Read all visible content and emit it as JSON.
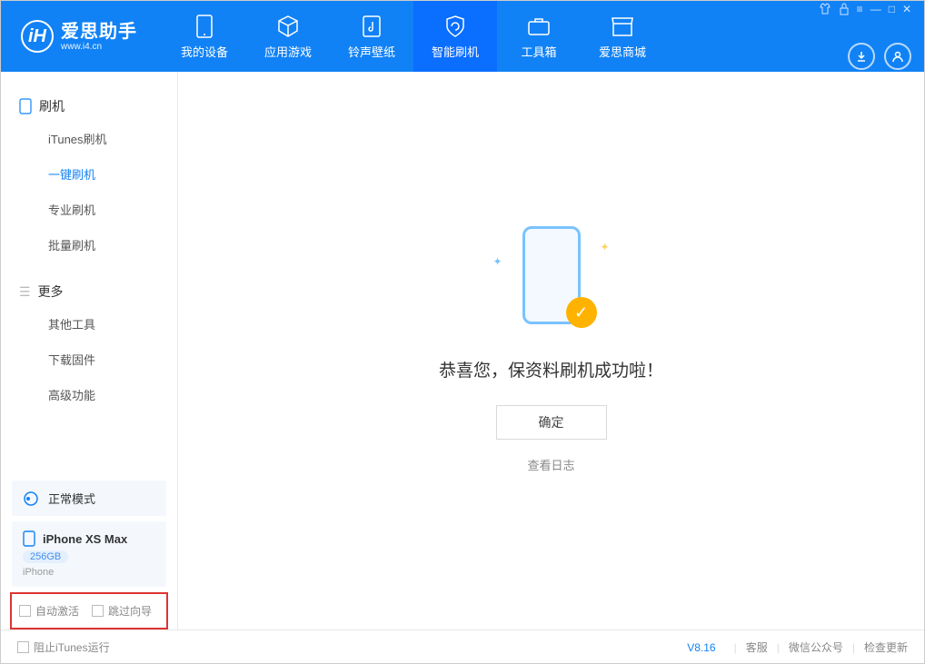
{
  "logo": {
    "title": "爱思助手",
    "sub": "www.i4.cn"
  },
  "nav": {
    "tabs": [
      {
        "label": "我的设备",
        "icon": "phone"
      },
      {
        "label": "应用游戏",
        "icon": "cube"
      },
      {
        "label": "铃声壁纸",
        "icon": "music-file"
      },
      {
        "label": "智能刷机",
        "icon": "refresh-shield",
        "active": true
      },
      {
        "label": "工具箱",
        "icon": "toolbox"
      },
      {
        "label": "爱思商城",
        "icon": "store"
      }
    ]
  },
  "sidebar": {
    "group1": {
      "label": "刷机",
      "items": [
        {
          "label": "iTunes刷机"
        },
        {
          "label": "一键刷机",
          "active": true
        },
        {
          "label": "专业刷机"
        },
        {
          "label": "批量刷机"
        }
      ]
    },
    "group2": {
      "label": "更多",
      "items": [
        {
          "label": "其他工具"
        },
        {
          "label": "下载固件"
        },
        {
          "label": "高级功能"
        }
      ]
    },
    "status": {
      "label": "正常模式"
    },
    "device": {
      "name": "iPhone XS Max",
      "storage": "256GB",
      "type": "iPhone"
    },
    "options": {
      "auto_activate": "自动激活",
      "skip_guide": "跳过向导"
    }
  },
  "main": {
    "success_message": "恭喜您，保资料刷机成功啦！",
    "ok_button": "确定",
    "view_log": "查看日志"
  },
  "footer": {
    "block_itunes": "阻止iTunes运行",
    "version": "V8.16",
    "links": {
      "support": "客服",
      "wechat": "微信公众号",
      "update": "检查更新"
    }
  }
}
